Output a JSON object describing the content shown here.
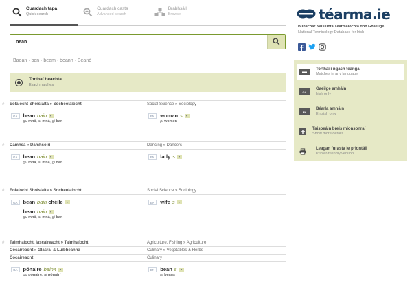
{
  "tabs": [
    {
      "label": "Cuardach tapa",
      "sub": "Quick search"
    },
    {
      "label": "Cuardach casta",
      "sub": "Advanced search"
    },
    {
      "label": "Brabhsáil",
      "sub": "Browse"
    }
  ],
  "search": {
    "value": "bean",
    "placeholder": ""
  },
  "suggestions": [
    "Baean",
    "ban",
    "beam",
    "beann",
    "Beanó"
  ],
  "exact": {
    "title": "Torthaí beachta",
    "sub": "Exact matches"
  },
  "entries": [
    {
      "domains": [
        {
          "ga": "Eolaíocht Shóisialta » Socheolaíocht",
          "en": "Social Science » Sociology"
        }
      ],
      "ga_terms": [
        {
          "lang": "GA",
          "term": "bean",
          "pos": "bain",
          "infl_g": "gu",
          "infl_gv": "mná",
          "infl_a": "ai",
          "infl_av": "mná",
          "infl_gi": "gi",
          "infl_giv": "ban"
        }
      ],
      "en_terms": [
        {
          "lang": "EN",
          "term": "woman",
          "pos": "s",
          "infl_p": "pl",
          "infl_pv": "women"
        }
      ]
    },
    {
      "domains": [
        {
          "ga": "Damhsa » Damhsóirí",
          "en": "Dancing » Dancers"
        }
      ],
      "ga_terms": [
        {
          "lang": "GA",
          "term": "bean",
          "pos": "bain",
          "infl_g": "gu",
          "infl_gv": "mná",
          "infl_a": "ai",
          "infl_av": "mná",
          "infl_gi": "gi",
          "infl_giv": "ban"
        }
      ],
      "en_terms": [
        {
          "lang": "EN",
          "term": "lady",
          "pos": "s"
        }
      ]
    },
    {
      "domains": [
        {
          "ga": "Eolaíocht Shóisialta » Socheolaíocht",
          "en": "Social Science » Sociology"
        }
      ],
      "ga_terms": [
        {
          "lang": "GA",
          "term": "bean",
          "pos": "bain",
          "extra": "chéile"
        },
        {
          "lang": "",
          "term": "bean",
          "pos": "bain",
          "infl_g": "gu",
          "infl_gv": "mná",
          "infl_a": "ai",
          "infl_av": "mná",
          "infl_gi": "gi",
          "infl_giv": "ban"
        }
      ],
      "en_terms": [
        {
          "lang": "EN",
          "term": "wife",
          "pos": "s"
        }
      ]
    },
    {
      "domains": [
        {
          "ga": "Talmhaíocht, Iascaireacht » Talmhaíocht",
          "en": "Agriculture, Fishing » Agriculture"
        },
        {
          "ga": "Cócaireacht » Glasraí & Luibheanna",
          "en": "Culinary » Vegetables & Herbs"
        },
        {
          "ga": "Cócaireacht",
          "en": "Culinary"
        }
      ],
      "ga_terms": [
        {
          "lang": "GA",
          "term": "pónaire",
          "pos": "bain4",
          "infl_g": "gu",
          "infl_gv": "pónaire",
          "infl_a": "ai",
          "infl_av": "pónairí"
        }
      ],
      "en_terms": [
        {
          "lang": "EN",
          "term": "bean",
          "pos": "s",
          "infl_p": "pl",
          "infl_pv": "beans"
        }
      ]
    }
  ],
  "brand": {
    "name": "téarma.ie",
    "tagline_ga": "Bunachar Náisiúnta Téarmaíochta don Ghaeilge",
    "tagline_en": "National Terminology Database for Irish",
    "color": "#1c3f63"
  },
  "panel": {
    "options": [
      {
        "icon": "—",
        "title": "Torthaí i ngach teanga",
        "sub": "Matches in any language"
      },
      {
        "icon": "GA",
        "title": "Gaeilge amháin",
        "sub": "Irish only"
      },
      {
        "icon": "EN",
        "title": "Béarla amháin",
        "sub": "English only"
      },
      {
        "icon": "+",
        "title": "Taispeáin breis mionsonraí",
        "sub": "Show more details"
      },
      {
        "icon": "print",
        "title": "Leagan furasta le priontáil",
        "sub": "Printer-friendly version"
      }
    ]
  },
  "colors": {
    "accent": "#e6e9c6",
    "green": "#7a9a2f",
    "twitter": "#1da1f2",
    "facebook": "#3b5998"
  }
}
